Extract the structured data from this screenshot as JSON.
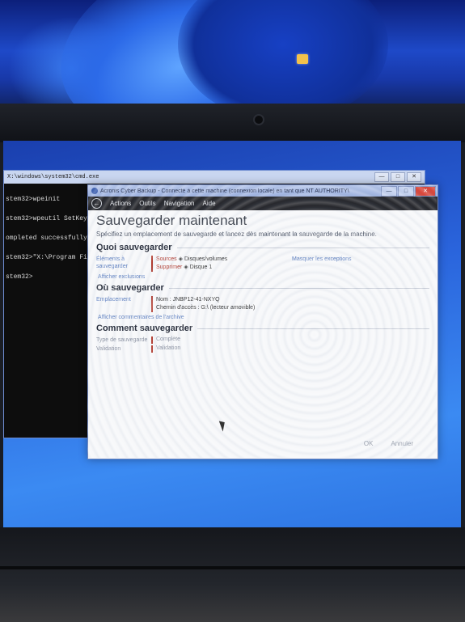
{
  "cmd": {
    "title": "X:\\windows\\system32\\cmd.exe",
    "lines": [
      "stem32>wpeinit",
      "stem32>wpeutil SetKeyb",
      "ompleted successfully.",
      "stem32>\"X:\\Program Fil",
      "stem32>"
    ]
  },
  "dialog": {
    "title": "Acronis Cyber Backup - Connecté à cette machine (connexion locale) en tant que NT AUTHORITY\\",
    "window_buttons": {
      "minimize": "—",
      "maximize": "□",
      "close": "✕"
    },
    "menu": [
      "Actions",
      "Outils",
      "Navigation",
      "Aide"
    ],
    "heading": "Sauvegarder maintenant",
    "subtitle": "Spécifiez un emplacement de sauvegarde et lancez dès maintenant la sauvegarde de la machine.",
    "what": {
      "heading": "Quoi sauvegarder",
      "items_label": "Éléments à sauvegarder",
      "source_label": "Sources",
      "source_value": "Disques/volumes",
      "target_label": "Supprimer",
      "target_value": "Disque 1",
      "manage_link": "Masquer les exceptions",
      "exclusions_link": "Afficher exclusions"
    },
    "where": {
      "heading": "Où sauvegarder",
      "location_label": "Emplacement",
      "name_line": "Nom : JNBP12-41-NXYQ",
      "path_line": "Chemin d'accès : G:\\ (lecteur amovible)",
      "options_link": "Afficher commentaires de l'archive"
    },
    "how": {
      "heading": "Comment sauvegarder",
      "type_label": "Type de sauvegarde",
      "type_value": "Complète",
      "validation_label": "Validation",
      "validation_value": "Validation"
    },
    "footer": {
      "ok": "OK",
      "cancel": "Annuler"
    }
  }
}
